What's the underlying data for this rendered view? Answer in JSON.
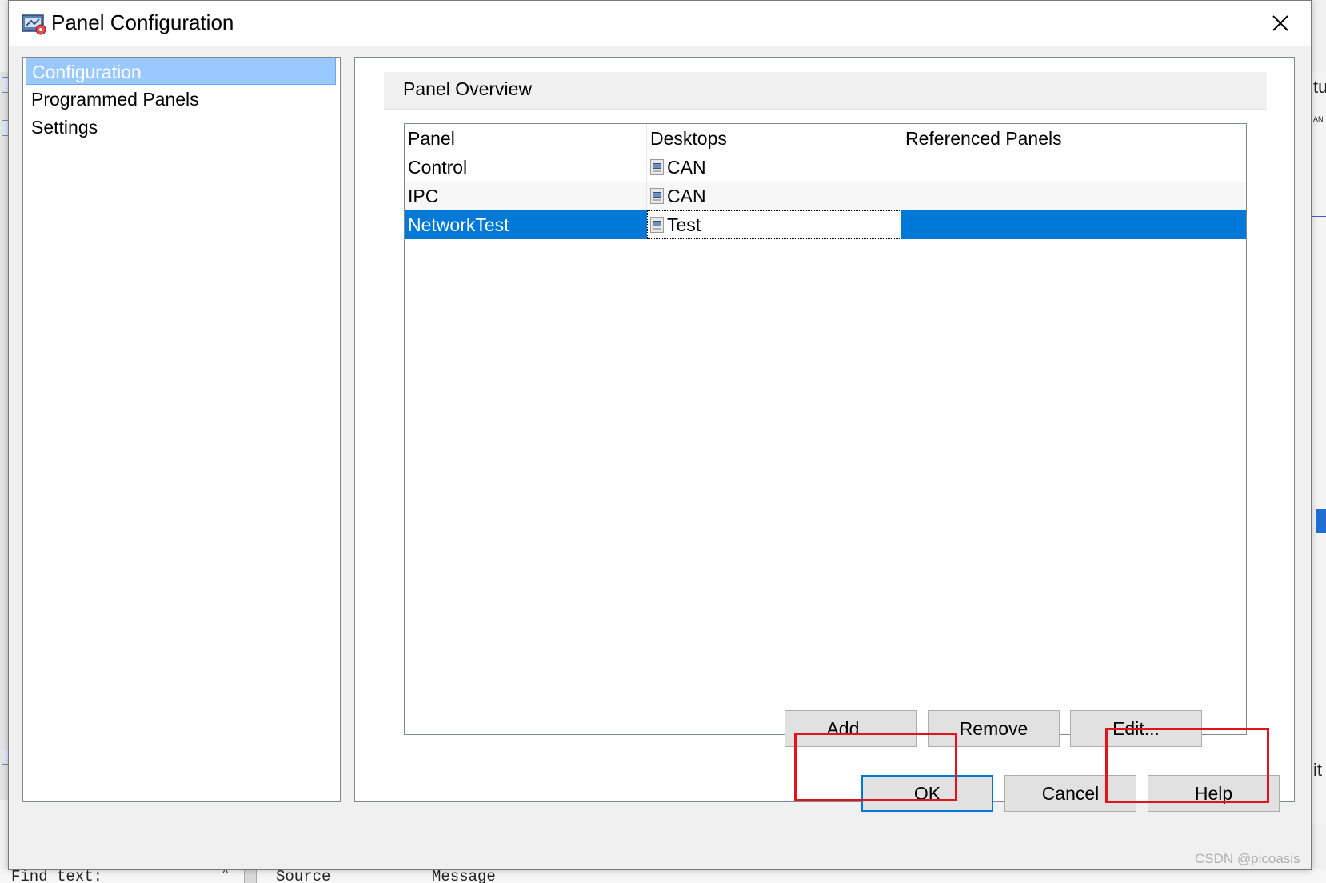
{
  "dialog": {
    "title": "Panel Configuration",
    "icon": "panel-config-icon",
    "close_glyph": "✕"
  },
  "nav": {
    "items": [
      {
        "label": "Configuration",
        "selected": true
      },
      {
        "label": "Programmed Panels",
        "selected": false
      },
      {
        "label": "Settings",
        "selected": false
      }
    ]
  },
  "overview": {
    "header": "Panel Overview",
    "columns": [
      "Panel",
      "Desktops",
      "Referenced Panels"
    ],
    "rows": [
      {
        "panel": "Control",
        "desktop": "CAN",
        "referenced": "",
        "selected": false
      },
      {
        "panel": "IPC",
        "desktop": "CAN",
        "referenced": "",
        "selected": false
      },
      {
        "panel": "NetworkTest",
        "desktop": "Test",
        "referenced": "",
        "selected": true
      }
    ],
    "buttons": {
      "add": "Add...",
      "remove": "Remove",
      "edit": "Edit..."
    }
  },
  "footer": {
    "ok": "OK",
    "cancel": "Cancel",
    "help": "Help"
  },
  "background": {
    "find_label": "Find text:",
    "source_label": "Source",
    "message_label": "Message",
    "right_fragments": [
      "tu",
      "AN",
      "it"
    ]
  },
  "watermark": "CSDN @picoasis",
  "colors": {
    "selection": "#0078d7",
    "nav_selection": "#99c9ff",
    "highlight": "#e0141b"
  }
}
